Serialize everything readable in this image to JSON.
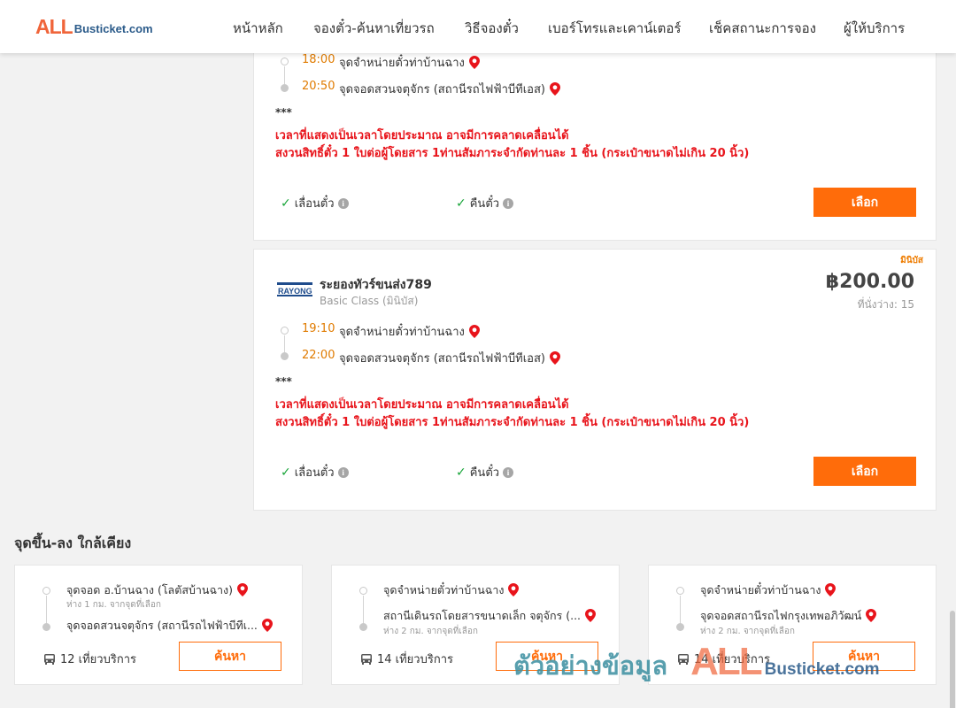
{
  "header": {
    "logo_all": "ALL",
    "logo_rest": "Busticket.com",
    "nav": [
      {
        "label": "หน้าหลัก"
      },
      {
        "label": "จองตั๋ว-ค้นหาเที่ยวรถ"
      },
      {
        "label": "วิธีจองตั๋ว"
      },
      {
        "label": "เบอร์โทรและเคาน์เตอร์"
      },
      {
        "label": "เช็คสถานะการจอง"
      },
      {
        "label": "ผู้ให้บริการ"
      }
    ]
  },
  "trip1": {
    "depart_time": "18:00",
    "depart_stop": "จุดจำหน่ายตั๋วท่าบ้านฉาง",
    "arrive_time": "20:50",
    "arrive_stop": "จุดจอดสวนจตุจักร (สถานีรถไฟฟ้าบีทีเอส)",
    "stars": "***",
    "note1": "เวลาที่แสดงเป็นเวลาโดยประมาณ อาจมีการคลาดเคลื่อนได้",
    "note2": "สงวนสิทธิ์ตั๋ว 1 ใบต่อผู้โดยสาร 1ท่านสัมภาระจำกัดท่านละ 1 ชิ้น (กระเป๋าขนาดไม่เกิน 20 นิ้ว)",
    "feature_postpone": "เลื่อนตั๋ว",
    "feature_refund": "คืนตั๋ว",
    "select_label": "เลือก"
  },
  "trip2": {
    "badge": "มินิบัส",
    "operator": "ระยองทัวร์ขนส่ง789",
    "operator_class": "Basic Class (มินิบัส)",
    "price": "฿200.00",
    "seats": "ที่นั่งว่าง: 15",
    "depart_time": "19:10",
    "depart_stop": "จุดจำหน่ายตั๋วท่าบ้านฉาง",
    "arrive_time": "22:00",
    "arrive_stop": "จุดจอดสวนจตุจักร (สถานีรถไฟฟ้าบีทีเอส)",
    "stars": "***",
    "note1": "เวลาที่แสดงเป็นเวลาโดยประมาณ อาจมีการคลาดเคลื่อนได้",
    "note2": "สงวนสิทธิ์ตั๋ว 1 ใบต่อผู้โดยสาร 1ท่านสัมภาระจำกัดท่านละ 1 ชิ้น (กระเป๋าขนาดไม่เกิน 20 นิ้ว)",
    "feature_postpone": "เลื่อนตั๋ว",
    "feature_refund": "คืนตั๋ว",
    "select_label": "เลือก",
    "logo_text": "RAYONG"
  },
  "nearby": {
    "title": "จุดขึ้น-ลง ใกล้เคียง",
    "cards": [
      {
        "from": "จุดจอด อ.บ้านฉาง (โลตัสบ้านฉาง)",
        "from_dist": "ห่าง 1 กม. จากจุดที่เลือก",
        "to": "จุดจอดสวนจตุจักร (สถานีรถไฟฟ้าบีทีเ...",
        "to_dist": "",
        "trips": "12 เที่ยวบริการ",
        "search": "ค้นหา"
      },
      {
        "from": "จุดจำหน่ายตั๋วท่าบ้านฉาง",
        "from_dist": "",
        "to": "สถานีเดินรถโดยสารขนาดเล็ก จตุจักร (...",
        "to_dist": "ห่าง 2 กม. จากจุดที่เลือก",
        "trips": "14 เที่ยวบริการ",
        "search": "ค้นหา"
      },
      {
        "from": "จุดจำหน่ายตั๋วท่าบ้านฉาง",
        "from_dist": "",
        "to": "จุดจอดสถานีรถไฟกรุงเทพอภิวัฒน์",
        "to_dist": "ห่าง 2 กม. จากจุดที่เลือก",
        "trips": "14 เที่ยวบริการ",
        "search": "ค้นหา"
      }
    ]
  },
  "watermark": {
    "text": "ตัวอย่างข้อมูล",
    "all": "ALL",
    "rest": "Busticket.com"
  },
  "colors": {
    "accent": "#ff6c0a",
    "note_red": "#e8141b",
    "time_orange": "#e07b00",
    "check_green": "#19a53a"
  }
}
